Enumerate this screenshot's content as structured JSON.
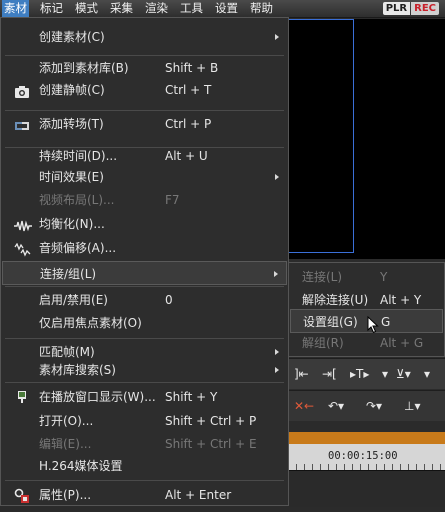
{
  "menubar": {
    "items": [
      "素材",
      "标记",
      "模式",
      "采集",
      "渲染",
      "工具",
      "设置",
      "帮助"
    ],
    "brand": {
      "plr": "PLR",
      "rec": "REC"
    }
  },
  "main_menu": {
    "items": [
      {
        "label": "创建素材(C)",
        "shortcut": "",
        "submenu": true,
        "disabled": false,
        "icon": ""
      },
      {
        "label": "添加到素材库(B)",
        "shortcut": "Shift + B",
        "submenu": false,
        "disabled": false,
        "icon": ""
      },
      {
        "label": "创建静帧(C)",
        "shortcut": "Ctrl + T",
        "submenu": false,
        "disabled": false,
        "icon": "camera-icon"
      },
      {
        "label": "添加转场(T)",
        "shortcut": "Ctrl + P",
        "submenu": false,
        "disabled": false,
        "icon": "transition-icon"
      },
      {
        "label": "持续时间(D)...",
        "shortcut": "Alt + U",
        "submenu": false,
        "disabled": false,
        "icon": ""
      },
      {
        "label": "时间效果(E)",
        "shortcut": "",
        "submenu": true,
        "disabled": false,
        "icon": ""
      },
      {
        "label": "视频布局(L)...",
        "shortcut": "F7",
        "submenu": false,
        "disabled": true,
        "icon": ""
      },
      {
        "label": "均衡化(N)...",
        "shortcut": "",
        "submenu": false,
        "disabled": false,
        "icon": "waveform-icon"
      },
      {
        "label": "音频偏移(A)...",
        "shortcut": "",
        "submenu": false,
        "disabled": false,
        "icon": "audio-offset-icon"
      },
      {
        "label": "连接/组(L)",
        "shortcut": "",
        "submenu": true,
        "disabled": false,
        "icon": "",
        "highlighted": true
      },
      {
        "label": "启用/禁用(E)",
        "shortcut": "0",
        "submenu": false,
        "disabled": false,
        "icon": ""
      },
      {
        "label": "仅启用焦点素材(O)",
        "shortcut": "",
        "submenu": false,
        "disabled": false,
        "icon": ""
      },
      {
        "label": "匹配帧(M)",
        "shortcut": "",
        "submenu": true,
        "disabled": false,
        "icon": ""
      },
      {
        "label": "素材库搜索(S)",
        "shortcut": "",
        "submenu": true,
        "disabled": false,
        "icon": ""
      },
      {
        "label": "在播放窗口显示(W)...",
        "shortcut": "Shift + Y",
        "submenu": false,
        "disabled": false,
        "icon": "monitor-icon"
      },
      {
        "label": "打开(O)...",
        "shortcut": "Shift + Ctrl + P",
        "submenu": false,
        "disabled": false,
        "icon": ""
      },
      {
        "label": "编辑(E)...",
        "shortcut": "Shift + Ctrl + E",
        "submenu": false,
        "disabled": true,
        "icon": ""
      },
      {
        "label": "H.264媒体设置",
        "shortcut": "",
        "submenu": false,
        "disabled": false,
        "icon": ""
      },
      {
        "label": "属性(P)...",
        "shortcut": "Alt + Enter",
        "submenu": false,
        "disabled": false,
        "icon": "properties-icon"
      }
    ]
  },
  "sub_menu": {
    "items": [
      {
        "label": "连接(L)",
        "shortcut": "Y",
        "disabled": true
      },
      {
        "label": "解除连接(U)",
        "shortcut": "Alt + Y",
        "disabled": false
      },
      {
        "label": "设置组(G)",
        "shortcut": "G",
        "disabled": false,
        "highlighted": true
      },
      {
        "label": "解组(R)",
        "shortcut": "Alt + G",
        "disabled": true
      }
    ]
  },
  "timeline": {
    "timecode": "00:00:15:00"
  },
  "colors": {
    "accent": "#3f7ec1",
    "menu_bg": "#2d2d2d",
    "disabled": "#777777",
    "preview_border": "#3a6fd8"
  }
}
